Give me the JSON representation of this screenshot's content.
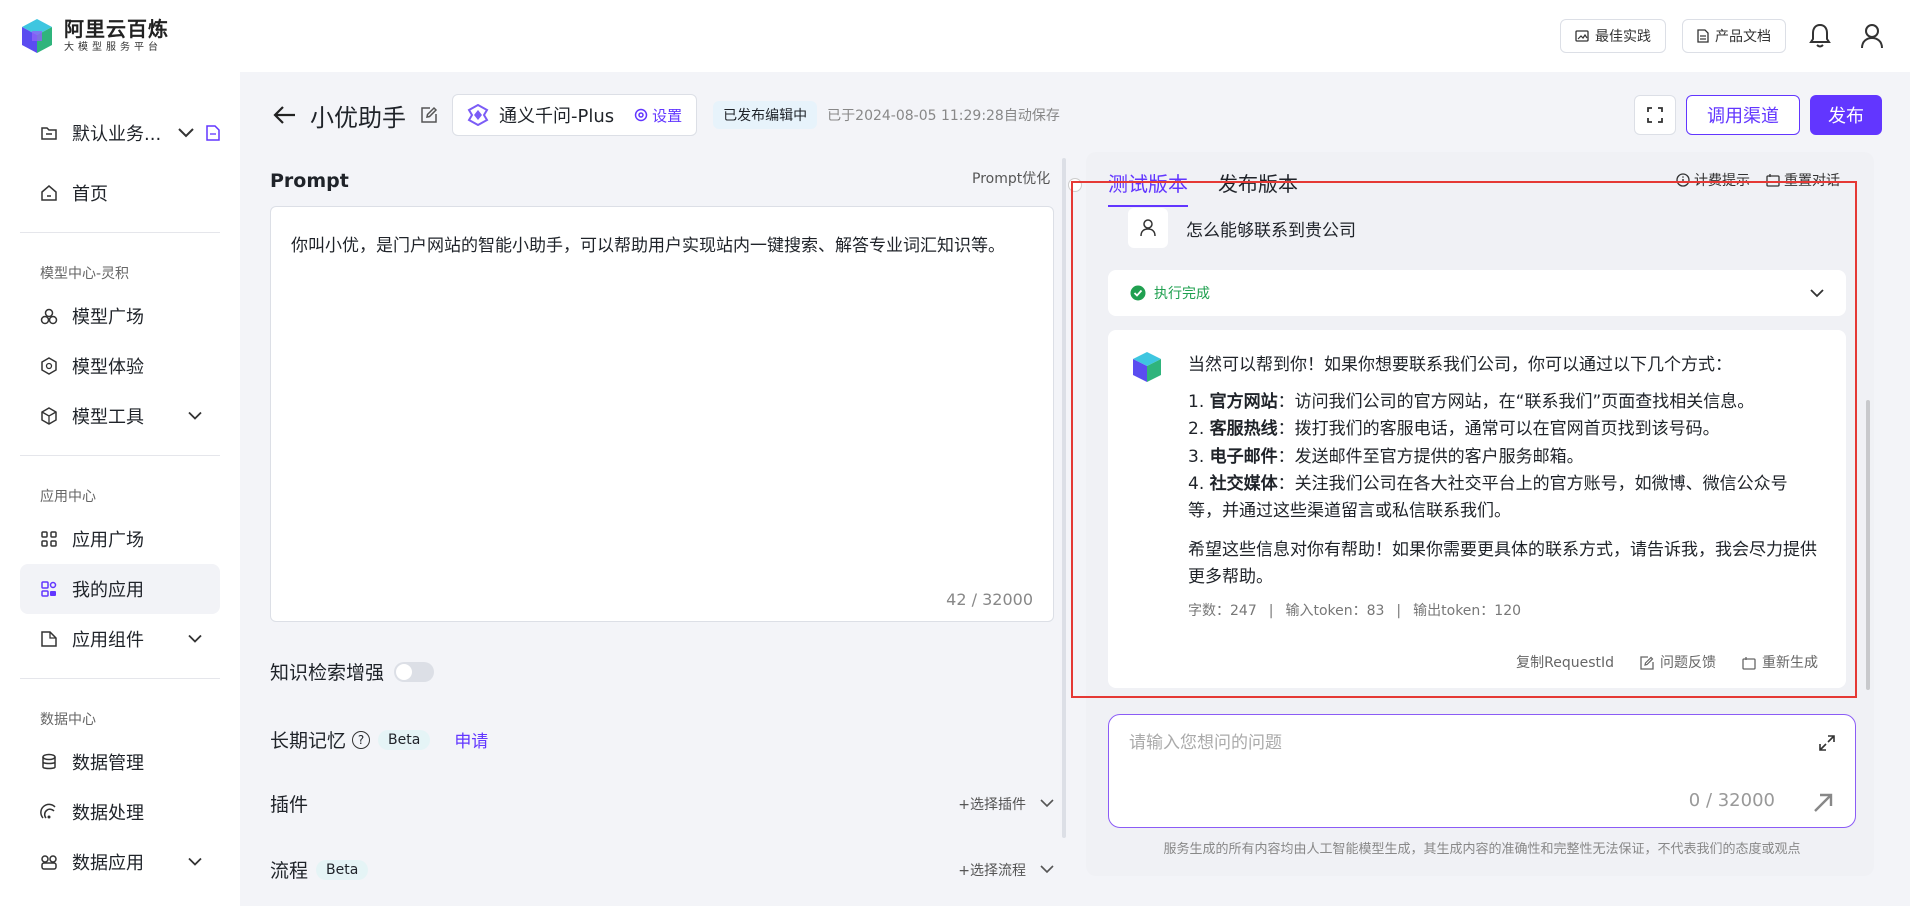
{
  "header": {
    "logo_title": "阿里云百炼",
    "logo_subtitle": "大模型服务平台",
    "best_practice": "最佳实践",
    "product_docs": "产品文档"
  },
  "sidebar": {
    "workspace": "默认业务...",
    "home": "首页",
    "section_model": "模型中心-灵积",
    "model_square": "模型广场",
    "model_experience": "模型体验",
    "model_tools": "模型工具",
    "section_app": "应用中心",
    "app_square": "应用广场",
    "my_apps": "我的应用",
    "app_components": "应用组件",
    "section_data": "数据中心",
    "data_manage": "数据管理",
    "data_process": "数据处理",
    "data_app": "数据应用"
  },
  "main": {
    "app_title": "小优助手",
    "model_name": "通义千问-Plus",
    "model_settings": "设置",
    "status_tag": "已发布编辑中",
    "saved_text": "已于2024-08-05 11:29:28自动保存",
    "call_channel": "调用渠道",
    "publish": "发布"
  },
  "config": {
    "prompt_label": "Prompt",
    "prompt_optimize": "Prompt优化",
    "prompt_text": "你叫小优，是门户网站的智能小助手，可以帮助用户实现站内一键搜索、解答专业词汇知识等。",
    "prompt_count": "42 / 32000",
    "knowledge_label": "知识检索增强",
    "memory_label": "长期记忆",
    "memory_beta": "Beta",
    "memory_apply": "申请",
    "plugin_label": "插件",
    "plugin_select": "+选择插件",
    "flow_label": "流程",
    "flow_beta": "Beta",
    "flow_select": "+选择流程"
  },
  "chat": {
    "tab_test": "测试版本",
    "tab_publish": "发布版本",
    "billing_tip": "计费提示",
    "reset_chat": "重置对话",
    "user_question": "怎么能够联系到贵公司",
    "exec_status": "执行完成",
    "answer_intro": "当然可以帮到你！如果你想要联系我们公司，你可以通过以下几个方式：",
    "items": [
      {
        "num": "1.",
        "title": "官方网站",
        "text": "：访问我们公司的官方网站，在“联系我们”页面查找相关信息。"
      },
      {
        "num": "2.",
        "title": "客服热线",
        "text": "：拨打我们的客服电话，通常可以在官网首页找到该号码。"
      },
      {
        "num": "3.",
        "title": "电子邮件",
        "text": "：发送邮件至官方提供的客户服务邮箱。"
      },
      {
        "num": "4.",
        "title": "社交媒体",
        "text": "：关注我们公司在各大社交平台上的官方账号，如微博、微信公众号等，并通过这些渠道留言或私信联系我们。"
      }
    ],
    "answer_outro": "希望这些信息对你有帮助！如果你需要更具体的联系方式，请告诉我，我会尽力提供更多帮助。",
    "meta_chars": "字数：247",
    "meta_input": "输入token：83",
    "meta_output": "输出token：120",
    "copy_request": "复制RequestId",
    "feedback": "问题反馈",
    "regenerate": "重新生成",
    "input_placeholder": "请输入您想问的问题",
    "input_count": "0 / 32000",
    "disclaimer": "服务生成的所有内容均由人工智能模型生成，其生成内容的准确性和完整性无法保证，不代表我们的态度或观点"
  },
  "colors": {
    "accent": "#6236ff",
    "success": "#20a050",
    "highlight_box": "#e53935"
  }
}
